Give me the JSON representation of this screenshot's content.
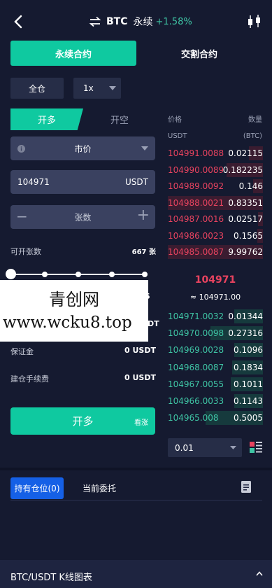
{
  "header": {
    "symbol": "BTC",
    "contract_kind": "永续",
    "change": "+1.58%",
    "icons": [
      "back-arrow-icon",
      "swap-icon",
      "candlestick-icon"
    ]
  },
  "contract_tabs": [
    "永续合约",
    "交割合约"
  ],
  "margin_mode": "全仓",
  "leverage": "1x",
  "side_tabs": [
    "开多",
    "开空"
  ],
  "order_type": "市价",
  "price_field": {
    "value": "104971",
    "unit": "USDT"
  },
  "qty_field": {
    "placeholder": "张数",
    "minus": "−",
    "plus": "+"
  },
  "available": {
    "label": "可开张数",
    "value": "667 张"
  },
  "slider": {
    "levels": 5,
    "position_fraction": 0.0
  },
  "overlay_watermark": {
    "line1": "青创网",
    "line2": "www.wcku8.top"
  },
  "overlay_peek": {
    "right_value": "5",
    "right_unit": "DT"
  },
  "margin": {
    "label": "保证金",
    "value": "0 USDT"
  },
  "fee": {
    "label": "建仓手续费",
    "value": "0 USDT"
  },
  "open_button": {
    "label": "开多",
    "sub": "看涨"
  },
  "orderbook": {
    "col_price": "价格",
    "col_qty": "数量",
    "unit_price": "USDT",
    "unit_qty": "(BTC)",
    "asks": [
      {
        "price": "104991.0088",
        "qty": "0.02115",
        "depth": 0.15
      },
      {
        "price": "104990.0089",
        "qty": "0.182235",
        "depth": 0.38
      },
      {
        "price": "104989.0092",
        "qty": "0.146",
        "depth": 0.1
      },
      {
        "price": "104988.0021",
        "qty": "0.83351",
        "depth": 1.0
      },
      {
        "price": "104987.0016",
        "qty": "0.02517",
        "depth": 0.05
      },
      {
        "price": "104986.0023",
        "qty": "0.1565",
        "depth": 0.06
      },
      {
        "price": "104985.0087",
        "qty": "9.99762",
        "depth": 1.0
      }
    ],
    "last_price": "104971",
    "index_price": "≈ 104971.00",
    "bids": [
      {
        "price": "104971.0032",
        "qty": "0.01344",
        "depth": 0.3
      },
      {
        "price": "104970.0098",
        "qty": "0.27316",
        "depth": 0.55
      },
      {
        "price": "104969.0028",
        "qty": "0.1096",
        "depth": 0.3
      },
      {
        "price": "104968.0087",
        "qty": "0.1834",
        "depth": 0.32
      },
      {
        "price": "104967.0055",
        "qty": "0.1011",
        "depth": 0.34
      },
      {
        "price": "104966.0033",
        "qty": "0.1143",
        "depth": 0.3
      },
      {
        "price": "104965.008",
        "qty": "0.5005",
        "depth": 0.6
      }
    ],
    "depth_value": "0.01"
  },
  "position_tabs": [
    "持有仓位(0)",
    "当前委托"
  ],
  "bottom_bar": {
    "label": "BTC/USDT  K线图表"
  },
  "colors": {
    "accent": "#0fc9a0",
    "ask": "#e8435f",
    "bid": "#3fc5a5",
    "blue": "#1560e6",
    "bg": "#151a30"
  }
}
